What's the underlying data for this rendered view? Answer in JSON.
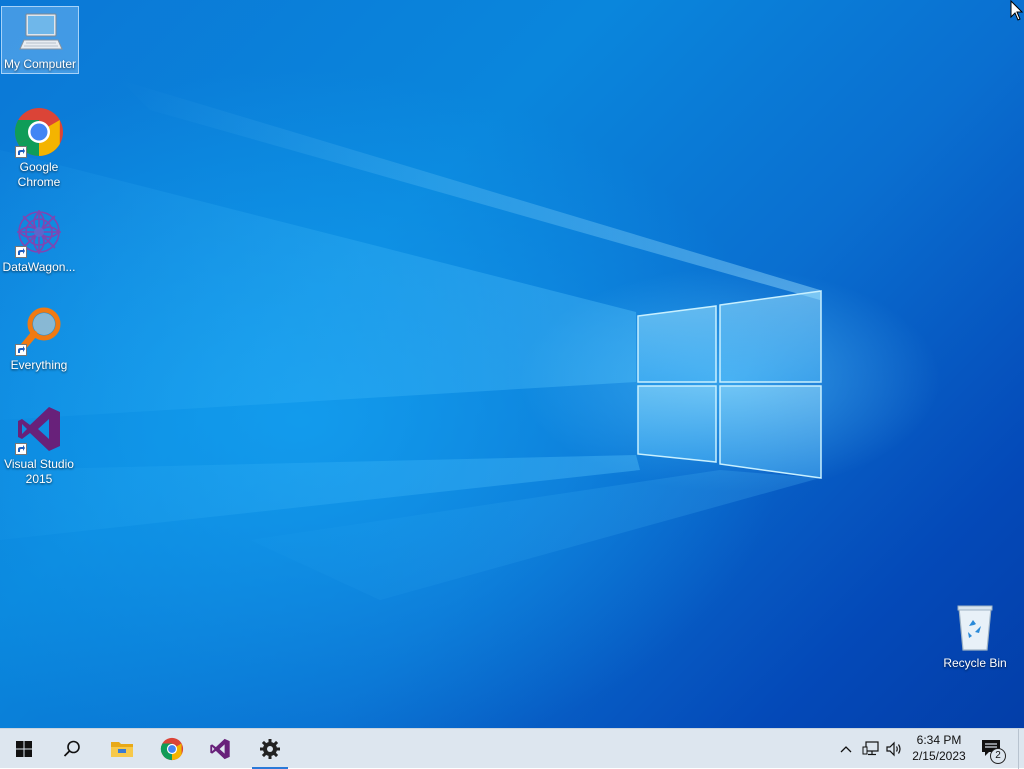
{
  "desktop": {
    "icons": [
      {
        "id": "my-computer",
        "label": "My Computer"
      },
      {
        "id": "google-chrome",
        "label": "Google Chrome"
      },
      {
        "id": "datawagon",
        "label": "DataWagon..."
      },
      {
        "id": "everything",
        "label": "Everything"
      },
      {
        "id": "visual-studio",
        "label": "Visual Studio 2015"
      },
      {
        "id": "recycle-bin",
        "label": "Recycle Bin"
      }
    ]
  },
  "taskbar": {
    "pinned": [
      "start-icon",
      "search-icon",
      "file-explorer-icon",
      "chrome-icon",
      "visual-studio-icon",
      "settings-icon"
    ],
    "active_app": "settings-icon",
    "tray": {
      "icons": [
        "chevron-up-icon",
        "network-icon",
        "volume-icon"
      ],
      "time": "6:34 PM",
      "date": "2/15/2023",
      "notification_count": "2"
    }
  },
  "colors": {
    "desktop_blue": "#0a7fd8",
    "taskbar_bg": "#dde6ef",
    "active_underline": "#2a79d8"
  }
}
